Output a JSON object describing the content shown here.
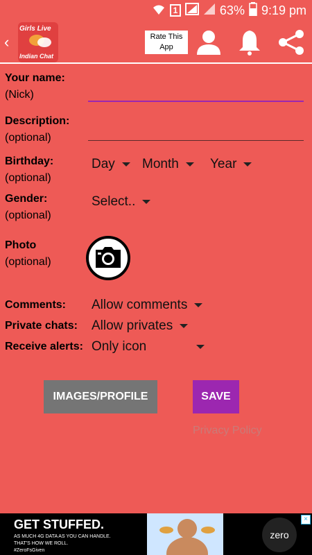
{
  "status_bar": {
    "sim": "1",
    "battery": "63%",
    "time": "9:19 pm"
  },
  "toolbar": {
    "logo_line1": "Girls Live",
    "logo_line2": "Indian Chat",
    "rate_line1": "Rate This",
    "rate_line2": "App"
  },
  "form": {
    "name_label": "Your name:",
    "name_sub": "(Nick)",
    "desc_label": "Description:",
    "desc_sub": "(optional)",
    "birthday_label": "Birthday:",
    "birthday_sub": "(optional)",
    "day": "Day",
    "month": "Month",
    "year": "Year",
    "gender_label": "Gender:",
    "gender_sub": "(optional)",
    "gender_value": "Select..",
    "photo_label": "Photo",
    "photo_sub": "(optional)",
    "comments_label": "Comments:",
    "comments_value": "Allow comments",
    "private_label": "Private chats:",
    "private_value": "Allow privates",
    "alerts_label": "Receive alerts:",
    "alerts_value": "Only icon"
  },
  "buttons": {
    "images_profile": "IMAGES/PROFILE",
    "save": "SAVE",
    "privacy": "Privacy Policy"
  },
  "ad": {
    "headline": "GET STUFFED.",
    "line1": "AS MUCH 4G DATA AS YOU CAN HANDLE.",
    "line2": "THAT'S HOW WE ROLL.",
    "line3": "#ZeroFsGiven",
    "brand": "zero",
    "close": "×"
  },
  "colors": {
    "background": "#ee5a56",
    "name_underline": "#9c27b0",
    "save_button": "#9c27b0",
    "images_button": "#757575"
  }
}
